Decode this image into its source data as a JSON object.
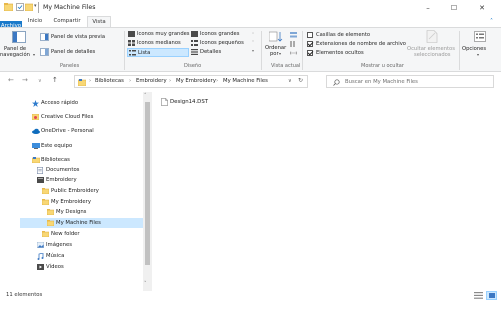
{
  "window": {
    "title": "My Machine Files",
    "controls": {
      "minimize": "–",
      "maximize": "☐",
      "close": "✕"
    }
  },
  "ribbon_tabs": [
    {
      "label": "Archivo"
    },
    {
      "label": "Inicio"
    },
    {
      "label": "Compartir"
    },
    {
      "label": "Vista"
    }
  ],
  "ribbon": {
    "panels": {
      "preview_pane": "Panel de vista previa",
      "nav_pane_line1": "Panel de",
      "nav_pane_line2": "navegación",
      "details_pane": "Panel de detalles",
      "group_title": "Paneles"
    },
    "layout": {
      "options": [
        "Iconos muy grandes",
        "Iconos grandes",
        "Iconos medianos",
        "Iconos pequeños",
        "Lista",
        "Detalles"
      ],
      "selected": "Lista",
      "group_title": "Diseño"
    },
    "current_view": {
      "sort_line1": "Ordenar",
      "sort_line2": "por",
      "group_title": "Vista actual"
    },
    "show_hide": {
      "checkboxes": [
        {
          "label": "Casillas de elemento",
          "checked": false
        },
        {
          "label": "Extensiones de nombre de archivo",
          "checked": true
        },
        {
          "label": "Elementos ocultos",
          "checked": true
        }
      ],
      "hide_selected_line1": "Ocultar elementos",
      "hide_selected_line2": "seleccionados",
      "group_title": "Mostrar u ocultar"
    },
    "options": {
      "label": "Opciones"
    }
  },
  "address_bar": {
    "breadcrumbs": [
      "Bibliotecas",
      "Embroidery",
      "My Embroidery",
      "My Machine Files"
    ],
    "search_placeholder": "Buscar en My Machine Files"
  },
  "nav_pane": {
    "items": [
      {
        "label": "Acceso rápido",
        "icon": "star-icon"
      },
      {
        "label": "Creative Cloud Files",
        "icon": "creative-cloud-folder-icon"
      },
      {
        "label": "OneDrive - Personal",
        "icon": "onedrive-cloud-icon"
      },
      {
        "label": "Este equipo",
        "icon": "computer-icon"
      },
      {
        "label": "Bibliotecas",
        "icon": "libraries-icon"
      },
      {
        "label": "Documentos",
        "icon": "documents-icon"
      },
      {
        "label": "Embroidery",
        "icon": "library-icon"
      },
      {
        "label": "Public Embroidery",
        "icon": "folder-icon"
      },
      {
        "label": "My Embroidery",
        "icon": "folder-icon"
      },
      {
        "label": "My Designs",
        "icon": "folder-icon"
      },
      {
        "label": "My Machine Files",
        "icon": "folder-icon",
        "selected": true
      },
      {
        "label": "New folder",
        "icon": "folder-icon"
      },
      {
        "label": "Imágenes",
        "icon": "pictures-icon"
      },
      {
        "label": "Música",
        "icon": "music-icon"
      },
      {
        "label": "Vídeos",
        "icon": "videos-icon"
      }
    ]
  },
  "content": {
    "files": [
      {
        "name": "Design14.DST",
        "icon": "file-icon"
      }
    ]
  },
  "status_bar": {
    "item_count": "11 elementos"
  },
  "colors": {
    "accent": "#1979ca",
    "selection": "#cce8ff",
    "selection_border": "#99d1ff",
    "folder": "#f8d775"
  }
}
